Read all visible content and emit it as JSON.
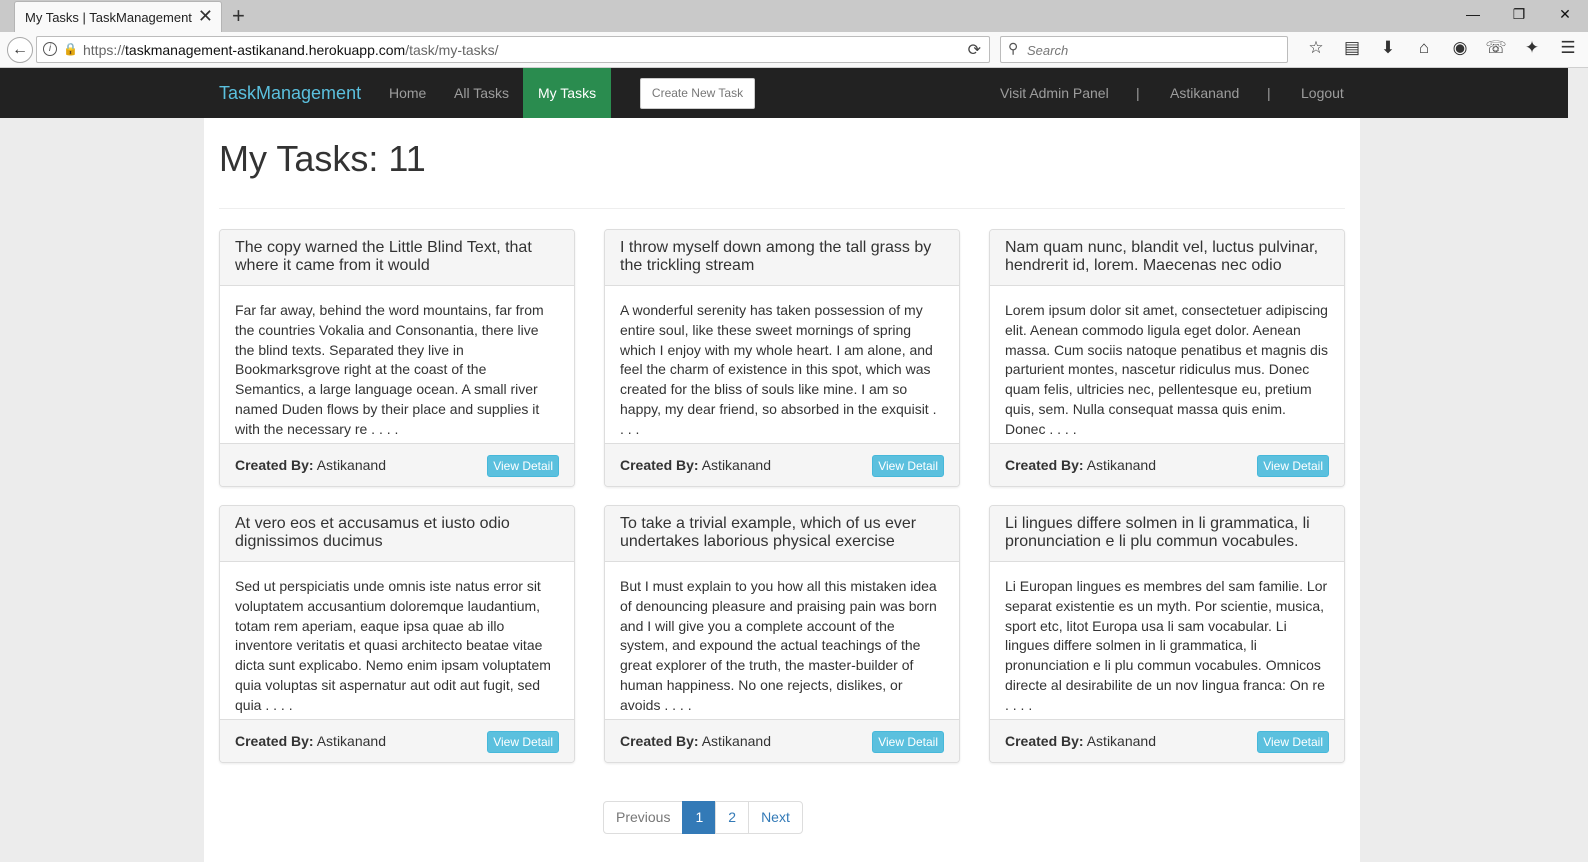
{
  "browser": {
    "tab_title": "My Tasks | TaskManagement",
    "tab_close": "✕",
    "new_tab": "+",
    "url_prefix": "https://",
    "url_host": "taskmanagement-astikanand.herokuapp.com",
    "url_path": "/task/my-tasks/",
    "search_placeholder": "Search",
    "minimize": "—",
    "restore": "❐",
    "close": "✕"
  },
  "app": {
    "brand": "TaskManagement",
    "nav": {
      "home": "Home",
      "all_tasks": "All Tasks",
      "my_tasks": "My Tasks",
      "create_new_task": "Create New Task",
      "admin_panel": "Visit Admin Panel",
      "separator": "|",
      "user": "Astikanand",
      "logout": "Logout"
    },
    "accent_color": "#2a8c4f",
    "brand_color": "#5bc0de"
  },
  "page": {
    "title": "My Tasks: 11"
  },
  "tasks": [
    {
      "title": "The copy warned the Little Blind Text, that where it came from it would",
      "body": "Far far away, behind the word mountains, far from the countries Vokalia and Consonantia, there live the blind texts. Separated they live in Bookmarksgrove right at the coast of the Semantics, a large language ocean. A small river named Duden flows by their place and supplies it with the necessary re . . . .",
      "created_by_label": "Created By:",
      "created_by": "Astikanand",
      "button": "View Detail"
    },
    {
      "title": "I throw myself down among the tall grass by the trickling stream",
      "body": "A wonderful serenity has taken possession of my entire soul, like these sweet mornings of spring which I enjoy with my whole heart. I am alone, and feel the charm of existence in this spot, which was created for the bliss of souls like mine. I am so happy, my dear friend, so absorbed in the exquisit . . . .",
      "created_by_label": "Created By:",
      "created_by": "Astikanand",
      "button": "View Detail"
    },
    {
      "title": "Nam quam nunc, blandit vel, luctus pulvinar, hendrerit id, lorem. Maecenas nec odio",
      "body": "Lorem ipsum dolor sit amet, consectetuer adipiscing elit. Aenean commodo ligula eget dolor. Aenean massa. Cum sociis natoque penatibus et magnis dis parturient montes, nascetur ridiculus mus. Donec quam felis, ultricies nec, pellentesque eu, pretium quis, sem. Nulla consequat massa quis enim. Donec . . . .",
      "created_by_label": "Created By:",
      "created_by": "Astikanand",
      "button": "View Detail"
    },
    {
      "title": "At vero eos et accusamus et iusto odio dignissimos ducimus",
      "body": "Sed ut perspiciatis unde omnis iste natus error sit voluptatem accusantium doloremque laudantium, totam rem aperiam, eaque ipsa quae ab illo inventore veritatis et quasi architecto beatae vitae dicta sunt explicabo. Nemo enim ipsam voluptatem quia voluptas sit aspernatur aut odit aut fugit, sed quia . . . .",
      "created_by_label": "Created By:",
      "created_by": "Astikanand",
      "button": "View Detail"
    },
    {
      "title": "To take a trivial example, which of us ever undertakes laborious physical exercise",
      "body": "But I must explain to you how all this mistaken idea of denouncing pleasure and praising pain was born and I will give you a complete account of the system, and expound the actual teachings of the great explorer of the truth, the master-builder of human happiness. No one rejects, dislikes, or avoids . . . .",
      "created_by_label": "Created By:",
      "created_by": "Astikanand",
      "button": "View Detail"
    },
    {
      "title": "Li lingues differe solmen in li grammatica, li pronunciation e li plu commun vocabules.",
      "body": "Li Europan lingues es membres del sam familie. Lor separat existentie es un myth. Por scientie, musica, sport etc, litot Europa usa li sam vocabular. Li lingues differe solmen in li grammatica, li pronunciation e li plu commun vocabules. Omnicos directe al desirabilite de un nov lingua franca: On re . . . .",
      "created_by_label": "Created By:",
      "created_by": "Astikanand",
      "button": "View Detail"
    }
  ],
  "pagination": {
    "previous": "Previous",
    "page1": "1",
    "page2": "2",
    "next": "Next"
  }
}
